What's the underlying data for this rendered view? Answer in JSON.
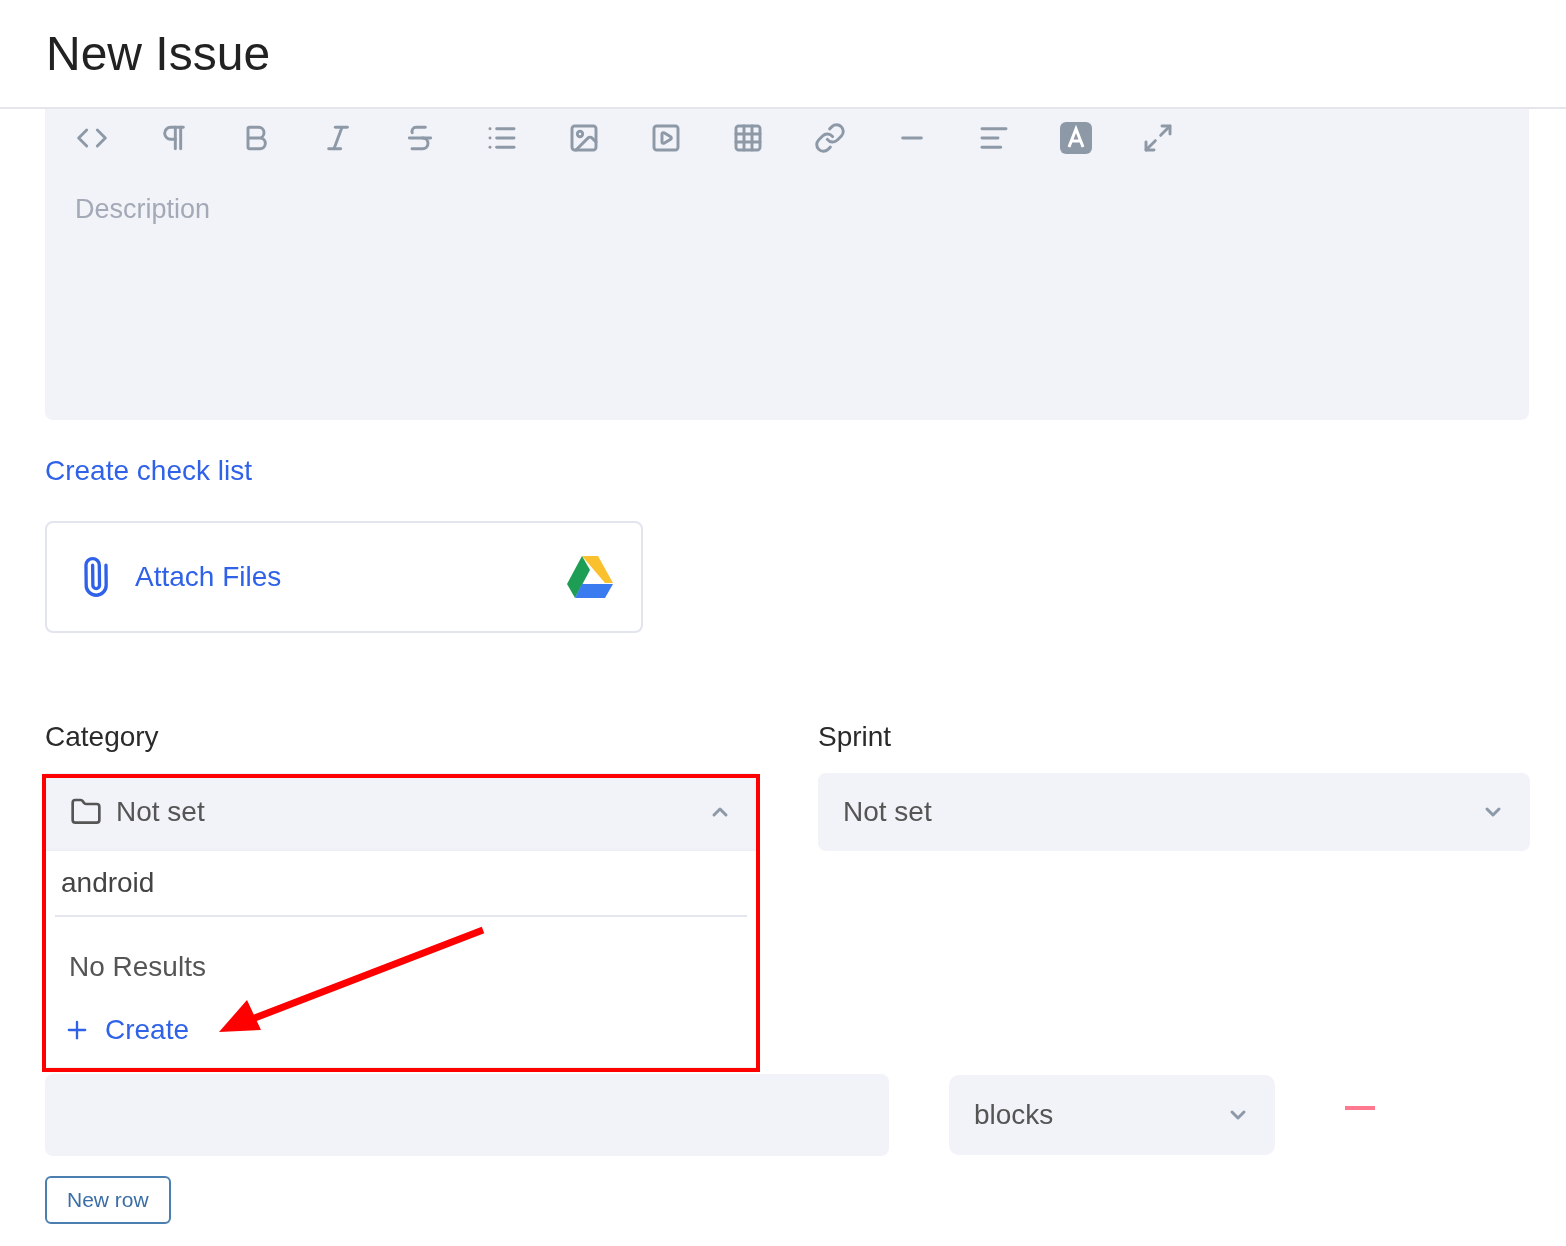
{
  "header": {
    "title": "New Issue"
  },
  "editor": {
    "placeholder": "Description"
  },
  "checklist_link": "Create check list",
  "attach": {
    "label": "Attach Files"
  },
  "fields": [
    {
      "label": "Category",
      "value": "Not set",
      "kind": "folder",
      "expanded": true
    },
    {
      "label": "Sprint",
      "value": "Not set",
      "kind": "plain",
      "expanded": false
    }
  ],
  "category_dropdown": {
    "search": "android",
    "empty_text": "No Results",
    "create_label": "Create"
  },
  "relation_row": {
    "type_value": "blocks"
  },
  "new_row_button": "New row"
}
